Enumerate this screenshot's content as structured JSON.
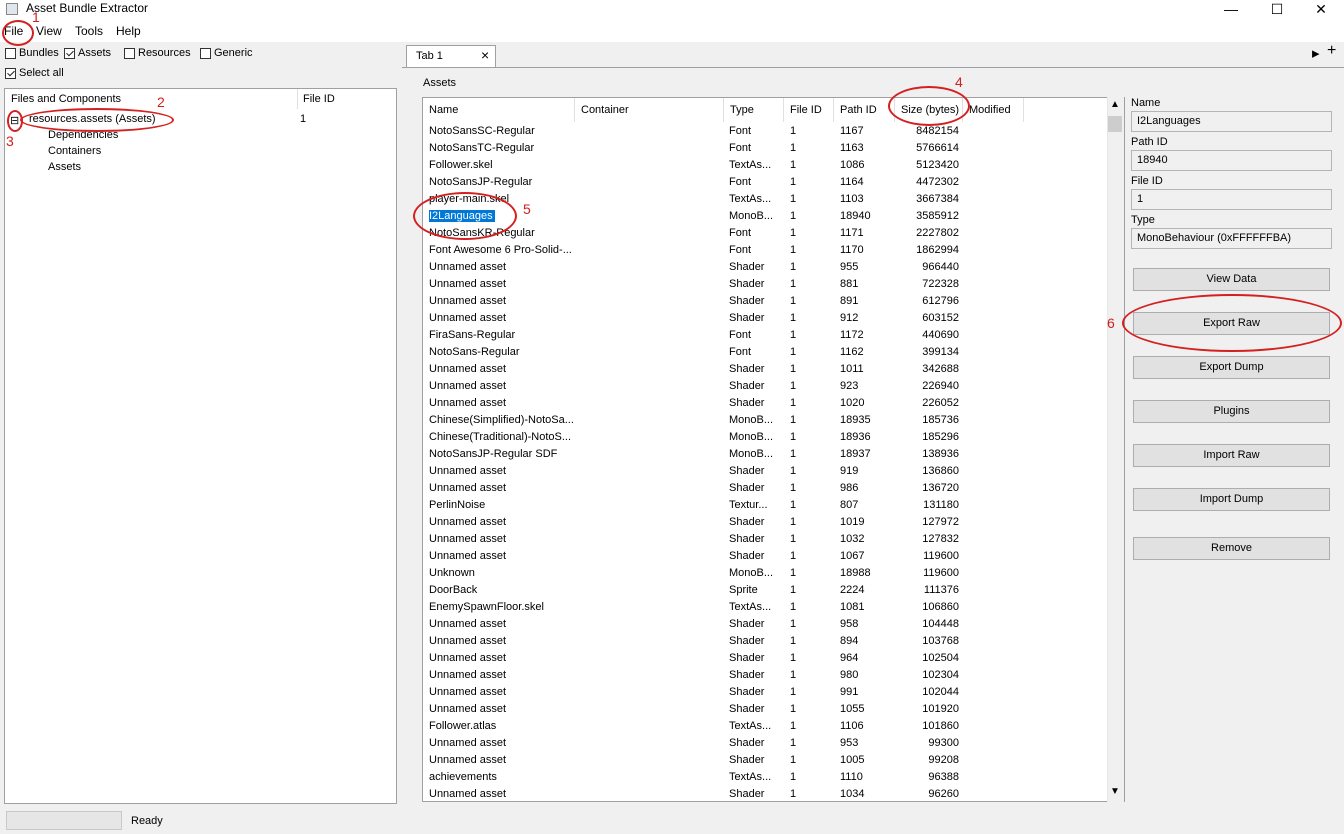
{
  "window": {
    "title": "Asset Bundle Extractor"
  },
  "menu": [
    "File",
    "View",
    "Tools",
    "Help"
  ],
  "filters": {
    "bundles": {
      "label": "Bundles",
      "checked": false
    },
    "assets": {
      "label": "Assets",
      "checked": true
    },
    "resources": {
      "label": "Resources",
      "checked": false
    },
    "generic": {
      "label": "Generic",
      "checked": false
    },
    "select_all": {
      "label": "Select all",
      "checked": true
    }
  },
  "tree": {
    "headers": {
      "name": "Files and Components",
      "file_id": "File ID"
    },
    "root": {
      "label": "resources.assets (Assets)",
      "file_id": "1",
      "expander": "⊟"
    },
    "children": [
      "Dependencies",
      "Containers",
      "Assets"
    ]
  },
  "tab": {
    "label": "Tab 1",
    "close": "×",
    "add": "+"
  },
  "assets_label": "Assets",
  "table": {
    "headers": [
      "Name",
      "Container",
      "Type",
      "File ID",
      "Path ID",
      "Size (bytes)",
      "Modified"
    ],
    "rows": [
      [
        "NotoSansSC-Regular",
        "Font",
        "1",
        "1167",
        "8482154"
      ],
      [
        "NotoSansTC-Regular",
        "Font",
        "1",
        "1163",
        "5766614"
      ],
      [
        "Follower.skel",
        "TextAs...",
        "1",
        "1086",
        "5123420"
      ],
      [
        "NotoSansJP-Regular",
        "Font",
        "1",
        "1164",
        "4472302"
      ],
      [
        "player-main.skel",
        "TextAs...",
        "1",
        "1103",
        "3667384"
      ],
      [
        "I2Languages",
        "MonoB...",
        "1",
        "18940",
        "3585912"
      ],
      [
        "NotoSansKR-Regular",
        "Font",
        "1",
        "1171",
        "2227802"
      ],
      [
        "Font Awesome 6 Pro-Solid-...",
        "Font",
        "1",
        "1170",
        "1862994"
      ],
      [
        "Unnamed asset",
        "Shader",
        "1",
        "955",
        "966440"
      ],
      [
        "Unnamed asset",
        "Shader",
        "1",
        "881",
        "722328"
      ],
      [
        "Unnamed asset",
        "Shader",
        "1",
        "891",
        "612796"
      ],
      [
        "Unnamed asset",
        "Shader",
        "1",
        "912",
        "603152"
      ],
      [
        "FiraSans-Regular",
        "Font",
        "1",
        "1172",
        "440690"
      ],
      [
        "NotoSans-Regular",
        "Font",
        "1",
        "1162",
        "399134"
      ],
      [
        "Unnamed asset",
        "Shader",
        "1",
        "1011",
        "342688"
      ],
      [
        "Unnamed asset",
        "Shader",
        "1",
        "923",
        "226940"
      ],
      [
        "Unnamed asset",
        "Shader",
        "1",
        "1020",
        "226052"
      ],
      [
        "Chinese(Simplified)-NotoSa...",
        "MonoB...",
        "1",
        "18935",
        "185736"
      ],
      [
        "Chinese(Traditional)-NotoS...",
        "MonoB...",
        "1",
        "18936",
        "185296"
      ],
      [
        "NotoSansJP-Regular SDF",
        "MonoB...",
        "1",
        "18937",
        "138936"
      ],
      [
        "Unnamed asset",
        "Shader",
        "1",
        "919",
        "136860"
      ],
      [
        "Unnamed asset",
        "Shader",
        "1",
        "986",
        "136720"
      ],
      [
        "PerlinNoise",
        "Textur...",
        "1",
        "807",
        "131180"
      ],
      [
        "Unnamed asset",
        "Shader",
        "1",
        "1019",
        "127972"
      ],
      [
        "Unnamed asset",
        "Shader",
        "1",
        "1032",
        "127832"
      ],
      [
        "Unnamed asset",
        "Shader",
        "1",
        "1067",
        "119600"
      ],
      [
        "Unknown",
        "MonoB...",
        "1",
        "18988",
        "119600"
      ],
      [
        "DoorBack",
        "Sprite",
        "1",
        "2224",
        "111376"
      ],
      [
        "EnemySpawnFloor.skel",
        "TextAs...",
        "1",
        "1081",
        "106860"
      ],
      [
        "Unnamed asset",
        "Shader",
        "1",
        "958",
        "104448"
      ],
      [
        "Unnamed asset",
        "Shader",
        "1",
        "894",
        "103768"
      ],
      [
        "Unnamed asset",
        "Shader",
        "1",
        "964",
        "102504"
      ],
      [
        "Unnamed asset",
        "Shader",
        "1",
        "980",
        "102304"
      ],
      [
        "Unnamed asset",
        "Shader",
        "1",
        "991",
        "102044"
      ],
      [
        "Unnamed asset",
        "Shader",
        "1",
        "1055",
        "101920"
      ],
      [
        "Follower.atlas",
        "TextAs...",
        "1",
        "1106",
        "101860"
      ],
      [
        "Unnamed asset",
        "Shader",
        "1",
        "953",
        "99300"
      ],
      [
        "Unnamed asset",
        "Shader",
        "1",
        "1005",
        "99208"
      ],
      [
        "achievements",
        "TextAs...",
        "1",
        "1110",
        "96388"
      ],
      [
        "Unnamed asset",
        "Shader",
        "1",
        "1034",
        "96260"
      ]
    ],
    "selected_row": 5
  },
  "details": {
    "name_label": "Name",
    "name_value": "I2Languages",
    "path_id_label": "Path ID",
    "path_id_value": "18940",
    "file_id_label": "File ID",
    "file_id_value": "1",
    "type_label": "Type",
    "type_value": "MonoBehaviour (0xFFFFFFBA)"
  },
  "buttons": [
    "View Data",
    "Export Raw",
    "Export Dump",
    "Plugins",
    "Import Raw",
    "Import Dump",
    "Remove"
  ],
  "status": {
    "text": "Ready"
  },
  "annotations": [
    "1",
    "2",
    "3",
    "4",
    "5",
    "6"
  ],
  "colors": {
    "selection": "#0078d7",
    "annotation": "#d42020"
  }
}
